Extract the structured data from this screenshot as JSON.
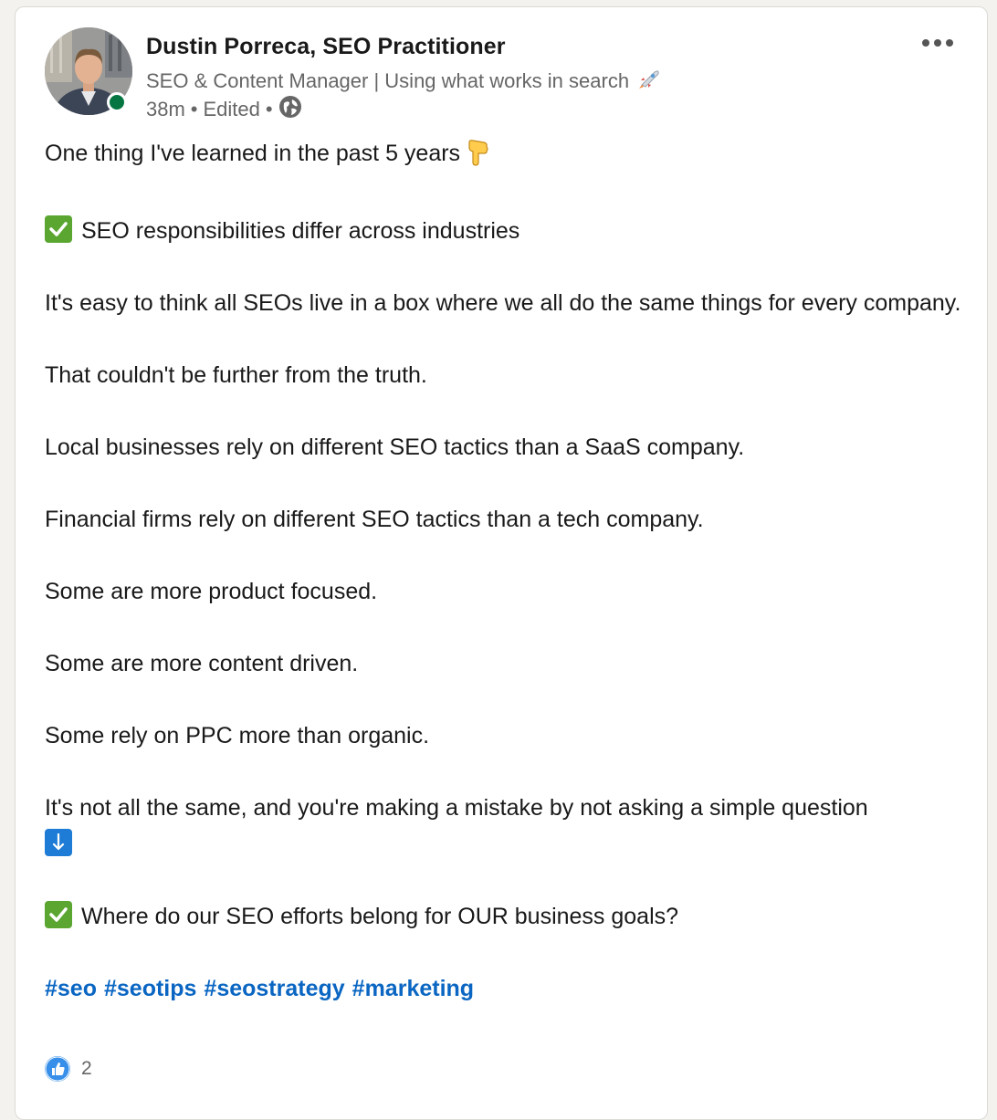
{
  "author": {
    "name": "Dustin Porreca, SEO Practitioner",
    "headline": "SEO & Content Manager | Using what works in search",
    "headline_icon": "rocket-emoji",
    "timestamp": "38m",
    "edited": "Edited",
    "separator": "•",
    "visibility_icon": "globe-icon",
    "presence": "online"
  },
  "post": {
    "intro": "One thing I've learned in the past 5 years",
    "intro_icon": "pointing-down-hand-emoji",
    "point1": "SEO responsibilities differ across industries",
    "para1": "It's easy to think all SEOs live in a box where we all do the same things for every company.",
    "para2": "That couldn't be further from the truth.",
    "para3": "Local businesses rely on different SEO tactics than a SaaS company.",
    "para4": "Financial firms rely on different SEO tactics than a tech company.",
    "para5": "Some are more product focused.",
    "para6": "Some are more content driven.",
    "para7": "Some rely on PPC more than organic.",
    "para8": "It's not all the same, and you're making a mistake by not asking a simple question",
    "point2": "Where do our SEO efforts belong for OUR business goals?",
    "hashtags": [
      "#seo",
      "#seotips",
      "#seostrategy",
      "#marketing"
    ]
  },
  "reactions": {
    "icon": "like-reaction-icon",
    "count": "2"
  },
  "colors": {
    "link": "#0a66c2",
    "presence_green": "#057642",
    "check_green": "#5aa630",
    "arrow_blue": "#1f7cd6",
    "like_blue": "#378fe9"
  }
}
